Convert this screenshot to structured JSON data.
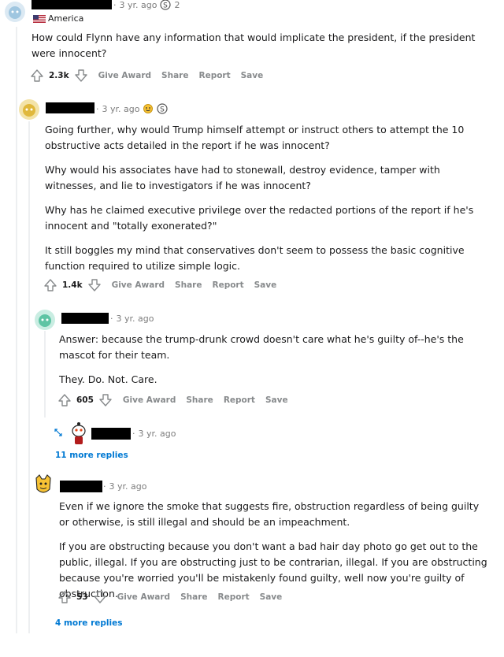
{
  "comments": [
    {
      "time": "3 yr. ago",
      "award_count": "2",
      "flair": "America",
      "paragraphs": [
        "How could Flynn have any information that would implicate the president, if the president were innocent?"
      ],
      "score": "2.3k"
    },
    {
      "time": "3 yr. ago",
      "paragraphs": [
        "Going further, why would Trump himself attempt or instruct others to attempt the 10 obstructive acts detailed in the report if he was innocent?",
        "Why would his associates have had to stonewall, destroy evidence, tamper with witnesses, and lie to investigators if he was innocent?",
        "Why has he claimed executive privilege over the redacted portions of the report if he's innocent and \"totally exonerated?\"",
        "It still boggles my mind that conservatives don't seem to possess the basic cognitive function required to utilize simple logic."
      ],
      "score": "1.4k"
    },
    {
      "time": "3 yr. ago",
      "paragraphs": [
        "Answer: because the trump-drunk crowd doesn't care what he's guilty of--he's the mascot for their team.",
        "They. Do. Not. Care."
      ],
      "score": "605"
    },
    {
      "time": "3 yr. ago",
      "more_replies": "11 more replies"
    },
    {
      "time": "3 yr. ago",
      "paragraphs": [
        "Even if we ignore the smoke that suggests fire, obstruction regardless of being guilty or otherwise, is still illegal and should be an impeachment.",
        "If you are obstructing because you don't want a bad hair day photo go get out to the public, illegal. If you are obstructing just to be contrarian, illegal. If you are obstructing because you're worried you'll be mistakenly found guilty, well now you're guilty of obstruction."
      ],
      "score": "53",
      "more_replies": "4 more replies"
    }
  ],
  "actions": {
    "give_award": "Give Award",
    "share": "Share",
    "report": "Report",
    "save": "Save"
  },
  "colors": {
    "link": "#0079d3",
    "muted": "#878a8c",
    "thread": "#edeff1"
  }
}
